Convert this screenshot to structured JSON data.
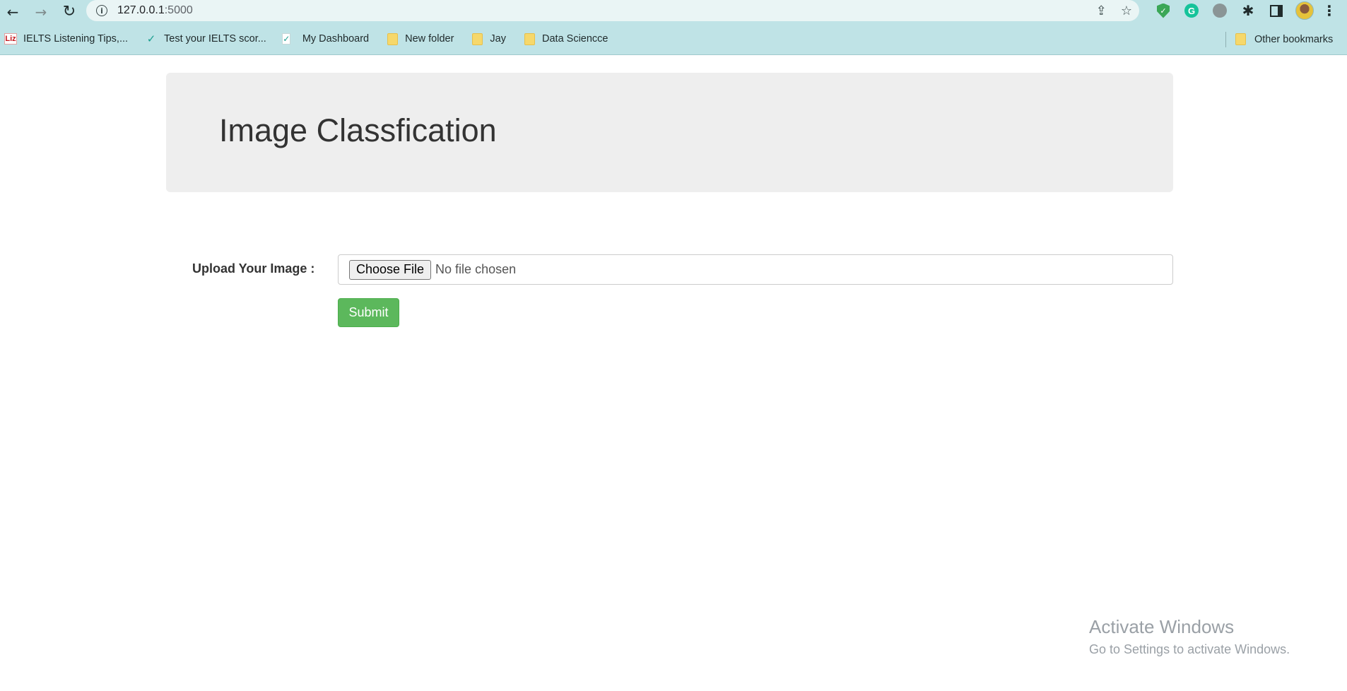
{
  "browser": {
    "url_host": "127.0.0.1",
    "url_port": ":5000",
    "bookmarks": [
      {
        "label": "IELTS Listening Tips,...",
        "icon": "liz-icon"
      },
      {
        "label": "Test your IELTS scor...",
        "icon": "check-icon"
      },
      {
        "label": "My Dashboard",
        "icon": "check-box-icon"
      },
      {
        "label": "New folder",
        "icon": "folder-icon"
      },
      {
        "label": "Jay",
        "icon": "folder-icon"
      },
      {
        "label": "Data Sciencce",
        "icon": "folder-icon"
      }
    ],
    "other_bookmarks": "Other bookmarks",
    "liz_text": "Liz"
  },
  "page": {
    "title": "Image Classfication",
    "upload_label": "Upload Your Image :",
    "choose_file": "Choose File",
    "no_file": "No file chosen",
    "submit": "Submit"
  },
  "watermark": {
    "title": "Activate Windows",
    "subtitle": "Go to Settings to activate Windows."
  },
  "colors": {
    "chrome": "#bfe3e6",
    "submit_green": "#5cb85c",
    "jumbotron": "#eeeeee"
  }
}
